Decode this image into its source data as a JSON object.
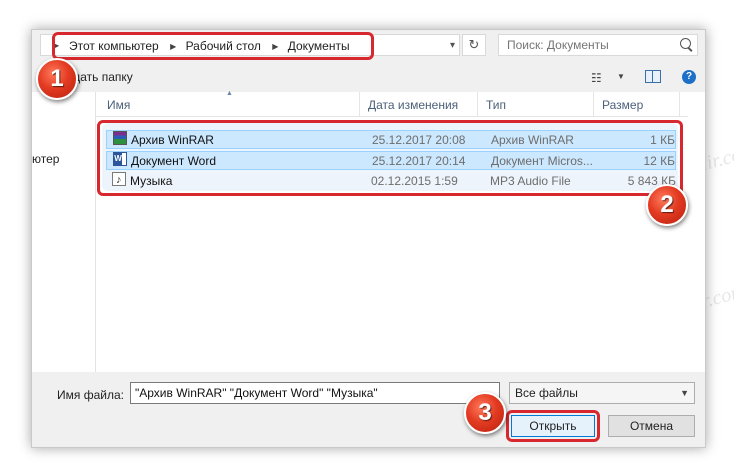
{
  "address": {
    "crumbs": [
      "Этот компьютер",
      "Рабочий стол",
      "Документы"
    ]
  },
  "search": {
    "placeholder": "Поиск: Документы"
  },
  "toolbar": {
    "new_folder": "здать папку"
  },
  "nav": {
    "item": "ютер"
  },
  "columns": {
    "name": "Имя",
    "date": "Дата изменения",
    "type": "Тип",
    "size": "Размер"
  },
  "files": [
    {
      "name": "Архив WinRAR",
      "date": "25.12.2017 20:08",
      "type": "Архив WinRAR",
      "size": "1 КБ",
      "icon": "winrar-archive-icon"
    },
    {
      "name": "Документ Word",
      "date": "25.12.2017 20:14",
      "type": "Документ Micros...",
      "size": "12 КБ",
      "icon": "word-document-icon"
    },
    {
      "name": "Музыка",
      "date": "02.12.2015 1:59",
      "type": "MP3 Audio File",
      "size": "5 843 КБ",
      "icon": "mp3-audio-icon"
    }
  ],
  "bottom": {
    "filename_label": "Имя файла:",
    "filename_value": "\"Архив WinRAR\" \"Документ Word\" \"Музыка\"",
    "filetype_value": "Все файлы",
    "open_label": "Открыть",
    "cancel_label": "Отмена"
  },
  "badges": {
    "one": "1",
    "two": "2",
    "three": "3"
  },
  "watermark": "Soringpcrepair.com",
  "colors": {
    "callout": "#d8282f",
    "selection": "#cce8ff",
    "accent": "#0078d7"
  }
}
